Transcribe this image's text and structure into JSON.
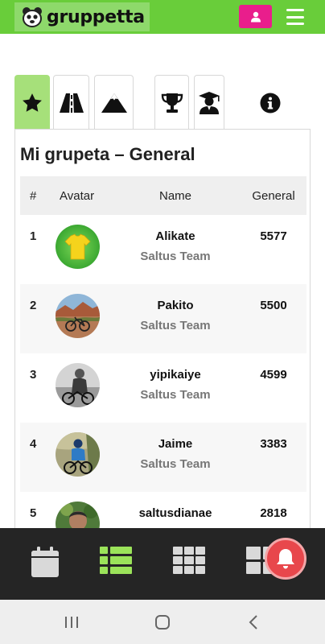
{
  "app": {
    "name": "gruppetta",
    "colors": {
      "brand_green": "#69cd3a",
      "accent_pink": "#e91e8c",
      "active_tab": "#a6e07a",
      "alert_red": "#e8474c"
    }
  },
  "header": {
    "logo_text": "gruppetta",
    "user_icon": "user-icon",
    "menu_icon": "hamburger-menu-icon"
  },
  "tabs": [
    {
      "icon": "star-icon",
      "active": true
    },
    {
      "icon": "road-icon",
      "active": false
    },
    {
      "icon": "mountain-icon",
      "active": false
    },
    {
      "icon": "trophy-icon",
      "active": false
    },
    {
      "icon": "graduate-icon",
      "active": false
    },
    {
      "icon": "info-icon",
      "active": false
    }
  ],
  "panel": {
    "title": "Mi grupeta – General",
    "columns": [
      "#",
      "Avatar",
      "Name",
      "General"
    ],
    "rows": [
      {
        "rank": "1",
        "name": "Alikate",
        "team": "Saltus Team",
        "score": "5577",
        "avatar": "yellow-jersey"
      },
      {
        "rank": "2",
        "name": "Pakito",
        "team": "Saltus Team",
        "score": "5500",
        "avatar": "bike-landscape"
      },
      {
        "rank": "3",
        "name": "yipikaiye",
        "team": "Saltus Team",
        "score": "4599",
        "avatar": "cyclist-bw"
      },
      {
        "rank": "4",
        "name": "Jaime",
        "team": "Saltus Team",
        "score": "3383",
        "avatar": "cyclist-blue"
      },
      {
        "rank": "5",
        "name": "saltusdianae",
        "team": "",
        "score": "2818",
        "avatar": "person-outdoor"
      }
    ]
  },
  "bottom_nav": [
    {
      "icon": "calendar-icon",
      "active": false
    },
    {
      "icon": "list-icon",
      "active": true
    },
    {
      "icon": "grid-icon",
      "active": false
    },
    {
      "icon": "dashboard-icon",
      "active": false
    }
  ],
  "notification": {
    "icon": "bell-icon"
  },
  "system_nav": [
    "recents-icon",
    "home-icon",
    "back-icon"
  ]
}
